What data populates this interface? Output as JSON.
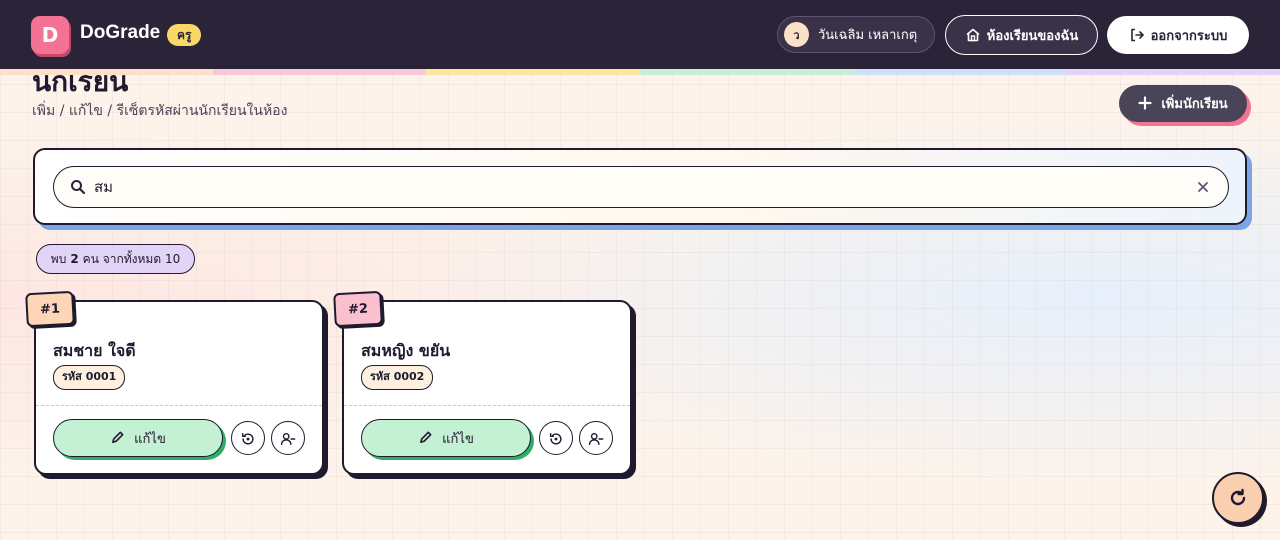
{
  "header": {
    "logo_letter": "D",
    "brand": "DoGrade",
    "role": "ครู",
    "user_initial": "ว",
    "user_name": "วันเฉลิม เหลาเกตุ",
    "my_classroom_label": "ห้องเรียนของฉัน",
    "logout_label": "ออกจากระบบ"
  },
  "page": {
    "title": "นักเรียน",
    "subtitle": "เพิ่ม / แก้ไข / รีเซ็ตรหัสผ่านนักเรียนในห้อง",
    "add_student_label": "เพิ่มนักเรียน"
  },
  "search": {
    "value": "สม",
    "placeholder": ""
  },
  "results": {
    "prefix": "พบ",
    "found": "2",
    "suffix": "คน จากทั้งหมด 10"
  },
  "students": [
    {
      "number": "#1",
      "name": "สมชาย ใจดี",
      "code": "รหัส 0001",
      "edit_label": "แก้ไข",
      "tag_color": "#fdd6b8"
    },
    {
      "number": "#2",
      "name": "สมหญิง ขยัน",
      "code": "รหัส 0002",
      "edit_label": "แก้ไข",
      "tag_color": "#f9c0d0"
    }
  ],
  "colors": {
    "topbar": "#2b2438",
    "accent_pink": "#f47395",
    "edit_green": "#c4f0d4",
    "pill_lavender": "#e1d4f6"
  },
  "icons": {
    "search": "search-icon",
    "clear": "close-icon",
    "edit": "pencil-icon",
    "reset": "reset-password-icon",
    "remove": "remove-user-icon",
    "refresh": "refresh-icon",
    "home": "home-icon",
    "logout": "logout-icon",
    "add": "plus-icon"
  }
}
